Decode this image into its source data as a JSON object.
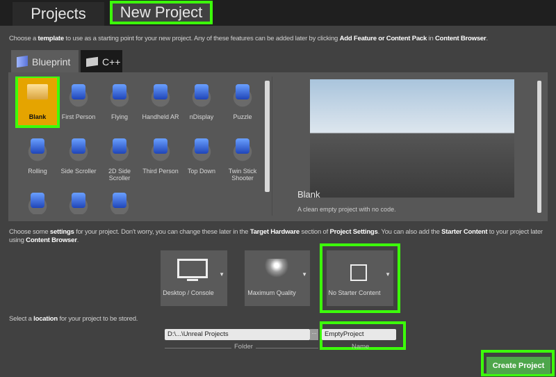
{
  "tabs": [
    {
      "label": "Projects",
      "active": false
    },
    {
      "label": "New Project",
      "active": true
    }
  ],
  "template_intro": {
    "pre": "Choose a ",
    "b1": "template",
    "mid": " to use as a starting point for your new project.  Any of these features can be added later by clicking ",
    "b2": "Add Feature or Content Pack",
    "mid2": " in ",
    "b3": "Content Browser",
    "end": "."
  },
  "language_tabs": [
    {
      "label": "Blueprint",
      "icon": "blueprint-icon",
      "active": true
    },
    {
      "label": "C++",
      "icon": "cpp-icon",
      "active": false
    }
  ],
  "templates": [
    "Blank",
    "First Person",
    "Flying",
    "Handheld AR",
    "nDisplay",
    "Puzzle",
    "Rolling",
    "Side Scroller",
    "2D Side Scroller",
    "Third Person",
    "Top Down",
    "Twin Stick Shooter",
    "",
    "",
    ""
  ],
  "selected_template": "Blank",
  "preview": {
    "title": "Blank",
    "description": "A clean empty project with no code."
  },
  "settings_intro": {
    "pre": "Choose some ",
    "b1": "settings",
    "mid": " for your project.  Don't worry, you can change these later in the ",
    "b2": "Target Hardware",
    "mid2": " section of ",
    "b3": "Project Settings",
    "mid3": ".  You can also add the ",
    "b4": "Starter Content",
    "mid4": " to your project later using ",
    "b5": "Content Browser",
    "end": "."
  },
  "settings": [
    {
      "label": "Desktop / Console",
      "icon": "monitor-icon"
    },
    {
      "label": "Maximum Quality",
      "icon": "quality-icon"
    },
    {
      "label": "No Starter Content",
      "icon": "box-icon"
    }
  ],
  "location_intro": {
    "pre": "Select a ",
    "b1": "location",
    "end": " for your project to be stored."
  },
  "folder": {
    "value": "D:\\...\\Unreal Projects",
    "label": "Folder",
    "browse": "..."
  },
  "name": {
    "value": "EmptyProject",
    "label": "Name"
  },
  "create_button": "Create Project",
  "colors": {
    "highlight": "#3cff0a",
    "selected_template": "#e5a400",
    "create": "#4ea64b"
  }
}
